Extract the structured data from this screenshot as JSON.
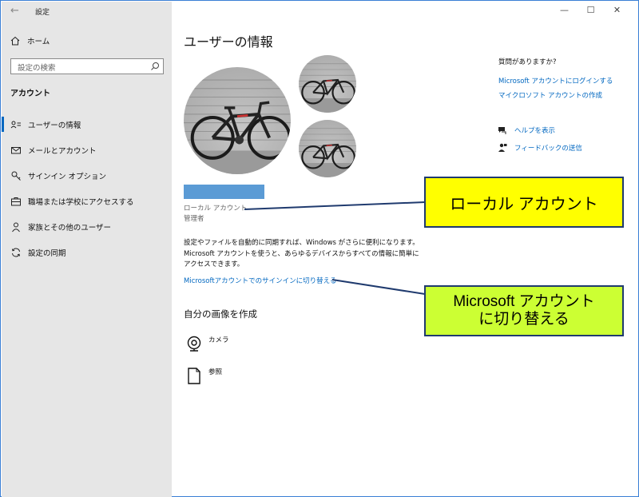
{
  "window": {
    "title": "設定",
    "controls": {
      "minimize": "—",
      "maximize": "☐",
      "close": "✕"
    }
  },
  "sidebar": {
    "home_label": "ホーム",
    "search_placeholder": "設定の検索",
    "section_title": "アカウント",
    "items": [
      {
        "label": "ユーザーの情報",
        "icon": "user-card-icon",
        "active": true
      },
      {
        "label": "メールとアカウント",
        "icon": "mail-icon",
        "active": false
      },
      {
        "label": "サインイン オプション",
        "icon": "key-icon",
        "active": false
      },
      {
        "label": "職場または学校にアクセスする",
        "icon": "briefcase-icon",
        "active": false
      },
      {
        "label": "家族とその他のユーザー",
        "icon": "person-icon",
        "active": false
      },
      {
        "label": "設定の同期",
        "icon": "sync-icon",
        "active": false
      }
    ]
  },
  "main": {
    "title": "ユーザーの情報",
    "account_type": "ローカル アカウント",
    "account_role": "管理者",
    "description": "設定やファイルを自動的に同期すれば、Windows がさらに便利になります。Microsoft アカウントを使うと、あらゆるデバイスからすべての情報に簡単にアクセスできます。",
    "switch_link": "Microsoftアカウントでのサインインに切り替える",
    "create_picture_title": "自分の画像を作成",
    "options": {
      "camera": "カメラ",
      "browse": "参照"
    }
  },
  "right_panel": {
    "question": "質問がありますか?",
    "links": [
      "Microsoft アカウントにログインする",
      "マイクロソフト アカウントの作成"
    ],
    "help": "ヘルプを表示",
    "feedback": "フィードバックの送信"
  },
  "callouts": {
    "local": "ローカル アカウント",
    "ms_line1": "Microsoft アカウント",
    "ms_line2": "に切り替える"
  },
  "colors": {
    "accent": "#0067c0",
    "sidebar_bg": "#e6e6e6",
    "name_bar": "#5b9bd5",
    "callout_yellow": "#ffff00",
    "callout_lime": "#ccff33",
    "callout_border": "#1f3a6e"
  }
}
